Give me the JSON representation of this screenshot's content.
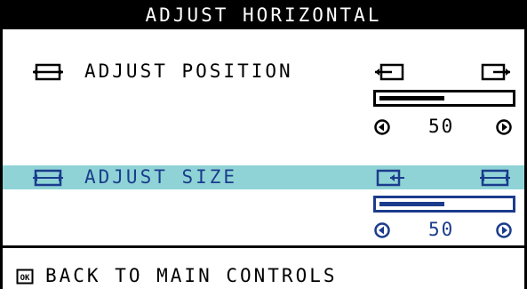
{
  "title": "ADJUST HORIZONTAL",
  "position": {
    "label": "ADJUST POSITION",
    "value": "50",
    "level_percent": 50
  },
  "size": {
    "label": "ADJUST SIZE",
    "value": "50",
    "level_percent": 50,
    "selected": true
  },
  "footer": {
    "label": "BACK TO MAIN CONTROLS",
    "ok_icon_text": "OK"
  },
  "colors": {
    "highlight": "#8fd3d6",
    "selected_text": "#1b3c8c",
    "frame": "#000000"
  },
  "icons": [
    "h-position-icon",
    "shift-left-icon",
    "shift-right-icon",
    "h-size-icon",
    "shrink-icon",
    "expand-icon",
    "decrease-icon",
    "increase-icon",
    "ok-icon"
  ]
}
